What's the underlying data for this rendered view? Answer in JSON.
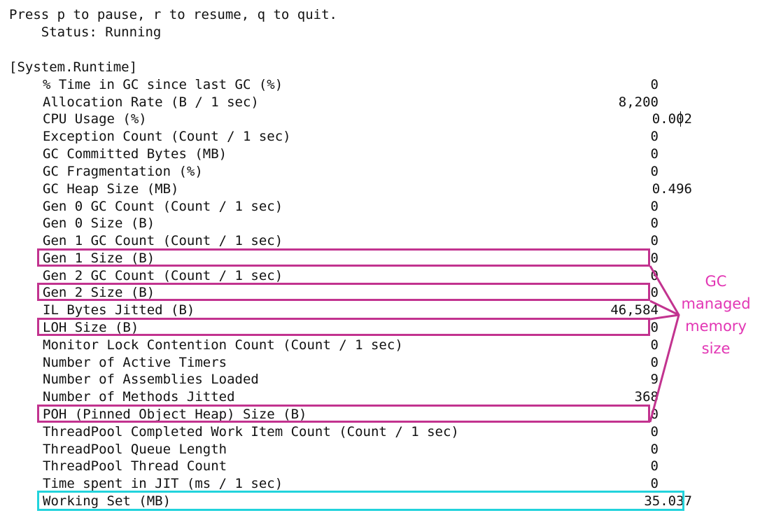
{
  "header": {
    "instructions": "Press p to pause, r to resume, q to quit.",
    "status": "    Status: Running"
  },
  "provider": "[System.Runtime]",
  "metrics": [
    {
      "label": "% Time in GC since last GC (%)",
      "value": "0"
    },
    {
      "label": "Allocation Rate (B / 1 sec)",
      "value": "8,200"
    },
    {
      "label": "CPU Usage (%)",
      "value": "0.002"
    },
    {
      "label": "Exception Count (Count / 1 sec)",
      "value": "0"
    },
    {
      "label": "GC Committed Bytes (MB)",
      "value": "0"
    },
    {
      "label": "GC Fragmentation (%)",
      "value": "0"
    },
    {
      "label": "GC Heap Size (MB)",
      "value": "0.496"
    },
    {
      "label": "Gen 0 GC Count (Count / 1 sec)",
      "value": "0"
    },
    {
      "label": "Gen 0 Size (B)",
      "value": "0"
    },
    {
      "label": "Gen 1 GC Count (Count / 1 sec)",
      "value": "0"
    },
    {
      "label": "Gen 1 Size (B)",
      "value": "0"
    },
    {
      "label": "Gen 2 GC Count (Count / 1 sec)",
      "value": "0"
    },
    {
      "label": "Gen 2 Size (B)",
      "value": "0"
    },
    {
      "label": "IL Bytes Jitted (B)",
      "value": "46,584"
    },
    {
      "label": "LOH Size (B)",
      "value": "0"
    },
    {
      "label": "Monitor Lock Contention Count (Count / 1 sec)",
      "value": "0"
    },
    {
      "label": "Number of Active Timers",
      "value": "0"
    },
    {
      "label": "Number of Assemblies Loaded",
      "value": "9"
    },
    {
      "label": "Number of Methods Jitted",
      "value": "368"
    },
    {
      "label": "POH (Pinned Object Heap) Size (B)",
      "value": "0"
    },
    {
      "label": "ThreadPool Completed Work Item Count (Count / 1 sec)",
      "value": "0"
    },
    {
      "label": "ThreadPool Queue Length",
      "value": "0"
    },
    {
      "label": "ThreadPool Thread Count",
      "value": "0"
    },
    {
      "label": "Time spent in JIT (ms / 1 sec)",
      "value": "0"
    },
    {
      "label": "Working Set (MB)",
      "value": "35.037"
    }
  ],
  "annotation": {
    "line1": "GC",
    "line2": "managed",
    "line3": "memory",
    "line4": "size"
  },
  "colors": {
    "gc_highlight": "#c2338f",
    "annotation_text": "#e236b4",
    "working_set_highlight": "#22d3dc"
  }
}
